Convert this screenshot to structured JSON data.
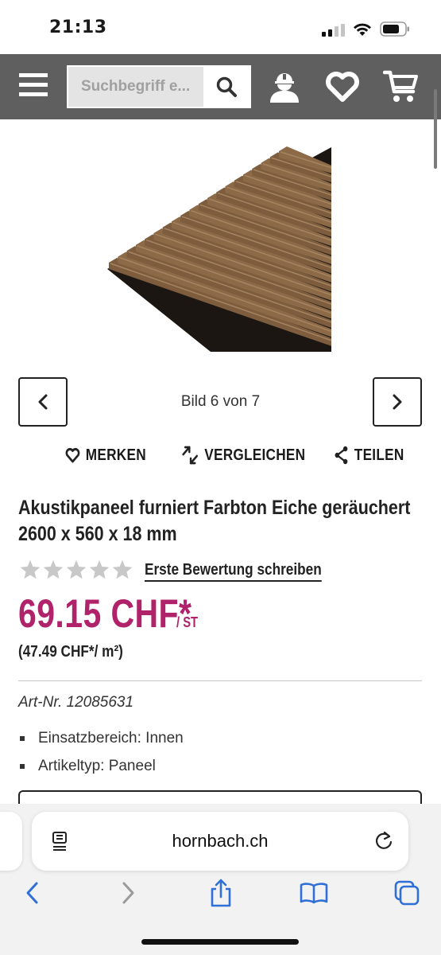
{
  "status_bar": {
    "time": "21:13"
  },
  "header": {
    "search_placeholder": "Suchbegriff e...",
    "icons": [
      "menu-icon",
      "search-icon",
      "account-icon",
      "wishlist-heart-icon",
      "cart-icon"
    ]
  },
  "gallery": {
    "counter": "Bild 6 von 7"
  },
  "actions": {
    "save": "MERKEN",
    "compare": "VERGLEICHEN",
    "share": "TEILEN"
  },
  "product": {
    "title_line1": "Akustikpaneel furniert Farbton Eiche geräuchert",
    "title_line2": "2600 x 560 x 18 mm",
    "rating_stars": 0,
    "rating_max": 5,
    "review_link": "Erste Bewertung schreiben",
    "price": "69.15 CHF*",
    "price_unit": "/ ST",
    "price_per_m2": "(47.49 CHF*/ m²)",
    "article_number": "Art-Nr. 12085631",
    "features": [
      "Einsatzbereich: Innen",
      "Artikeltyp: Paneel"
    ]
  },
  "browser": {
    "url": "hornbach.ch"
  },
  "colors": {
    "header_bg": "#5f5f5f",
    "price": "#b0226a",
    "safari_blue": "#2f6fd6"
  }
}
